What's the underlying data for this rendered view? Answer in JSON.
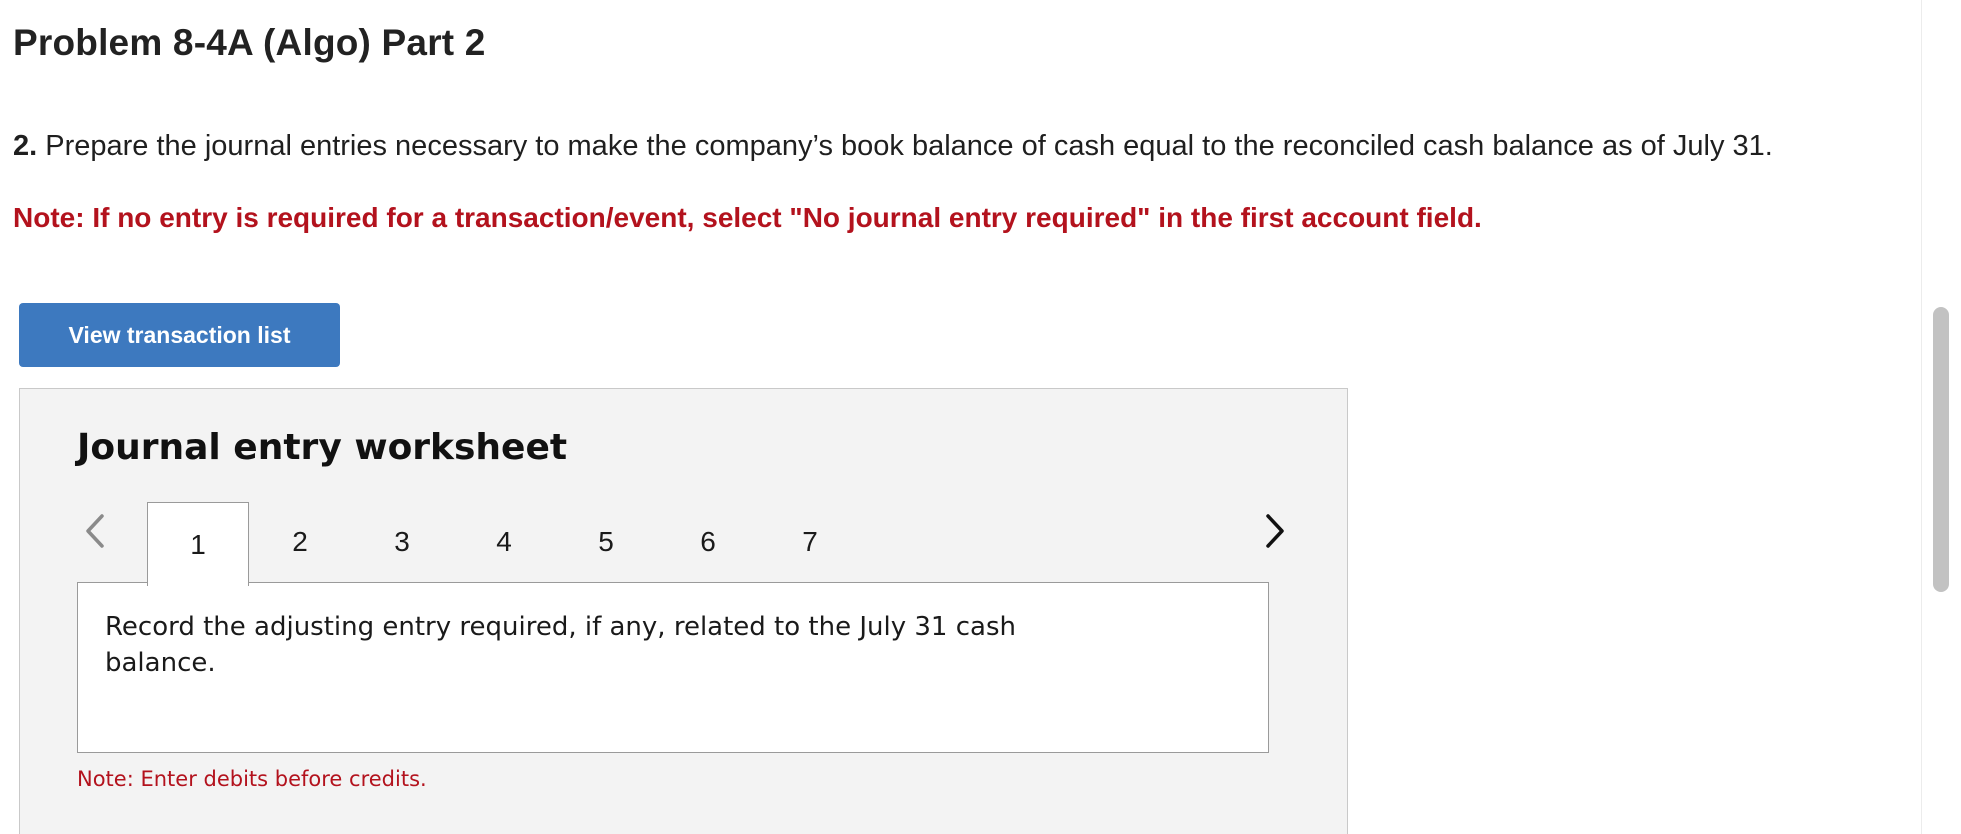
{
  "header": {
    "title": "Problem 8-4A (Algo) Part 2"
  },
  "instructions": {
    "number": "2.",
    "text": " Prepare the journal entries necessary to make the company’s book balance of cash equal to the reconciled cash balance as of July 31.",
    "note": "Note: If no entry is required for a transaction/event, select \"No journal entry required\" in the first account field."
  },
  "actions": {
    "view_transaction_list": "View transaction list"
  },
  "worksheet": {
    "title": "Journal entry worksheet",
    "tabs": [
      "1",
      "2",
      "3",
      "4",
      "5",
      "6",
      "7"
    ],
    "active_tab": "1",
    "prompt": "Record the adjusting entry required, if any, related to the July 31 cash balance.",
    "note": "Note: Enter debits before credits.",
    "icons": {
      "prev": "chevron-left-icon",
      "next": "chevron-right-icon"
    }
  },
  "colors": {
    "accent_blue": "#3d79bf",
    "note_red": "#b3121d",
    "worksheet_bg": "#f3f3f3"
  }
}
